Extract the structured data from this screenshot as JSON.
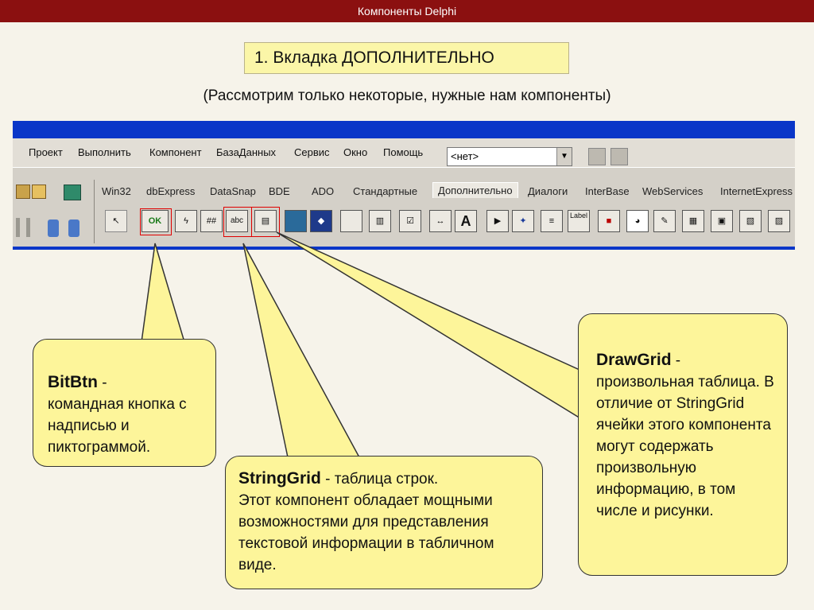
{
  "header": {
    "title": "Компоненты Delphi"
  },
  "heading": "1. Вкладка ДОПОЛНИТЕЛЬНО",
  "subheading": "(Рассмотрим только некоторые, нужные нам компоненты)",
  "ide": {
    "menu": [
      "Проект",
      "Выполнить",
      "Компонент",
      "БазаДанных",
      "Сервис",
      "Окно",
      "Помощь"
    ],
    "combo_value": "<нет>",
    "tabs": [
      "Win32",
      "dbExpress",
      "DataSnap",
      "BDE",
      "ADO",
      "Стандартные",
      "Дополнительно",
      "Диалоги",
      "InterBase",
      "WebServices",
      "InternetExpress"
    ],
    "active_tab": "Дополнительно",
    "button_icon_label": "OK",
    "grid_icon_label": "abc",
    "edit_icon_label": "A",
    "labeled_edit_icon_label": "Label"
  },
  "callouts": {
    "bitbtn": {
      "name": "BitBtn",
      "dash": " -",
      "text": "командная кнопка с надписью и пиктограммой."
    },
    "stringgrid": {
      "name": "StringGrid",
      "dash": " - таблица строк.",
      "text": "Этот компонент обладает мощными возможностями для представления текстовой информации в табличном виде."
    },
    "drawgrid": {
      "name": "DrawGrid",
      "dash": " -",
      "text": "произвольная таблица. В отличие от StringGrid ячейки этого компонента могут содержать произвольную информацию, в том числе и рисунки."
    }
  },
  "colors": {
    "header_bg": "#8b1010",
    "callout_bg": "#fdf59a",
    "highlight": "#e00000",
    "heading_bg": "#fbf6a8"
  }
}
